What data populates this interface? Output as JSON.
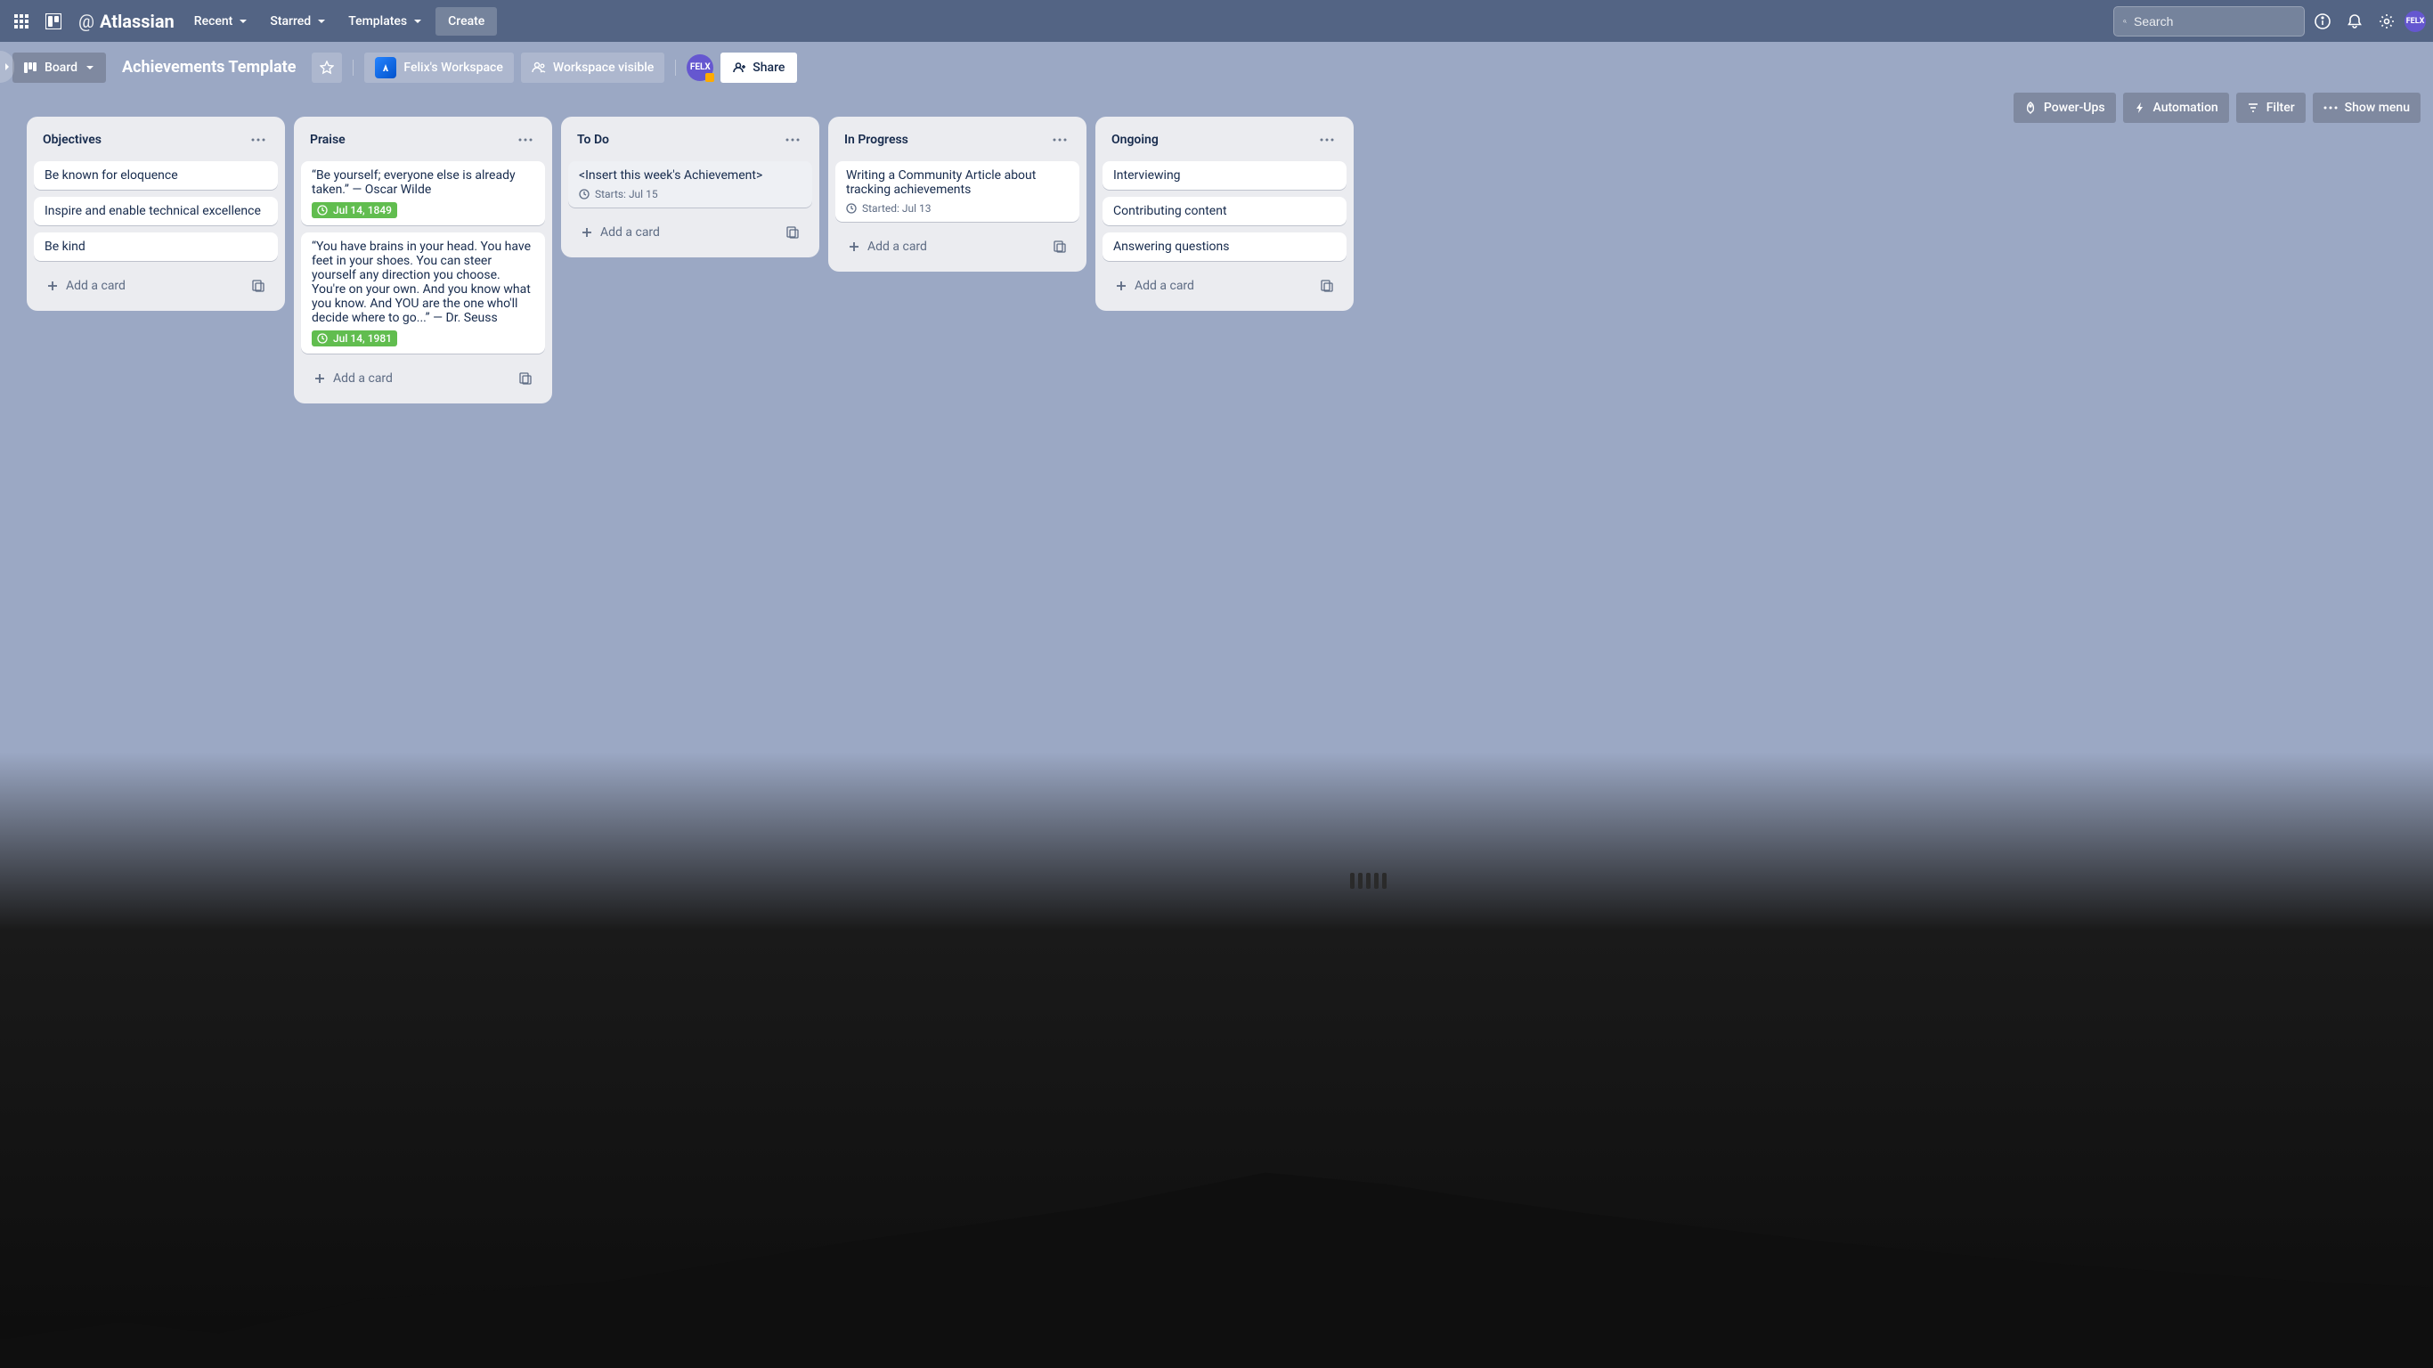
{
  "topnav": {
    "logo": "Atlassian",
    "menus": [
      "Recent",
      "Starred",
      "Templates"
    ],
    "create": "Create",
    "search_placeholder": "Search",
    "avatar": "FELX"
  },
  "boardbar": {
    "view_switch": "Board",
    "title": "Achievements Template",
    "workspace": "Felix's Workspace",
    "visibility": "Workspace visible",
    "member": "FELX",
    "share": "Share"
  },
  "toolbar": {
    "powerups": "Power-Ups",
    "automation": "Automation",
    "filter": "Filter",
    "show_menu": "Show menu"
  },
  "add_card_label": "Add a card",
  "lists": [
    {
      "title": "Objectives",
      "cards": [
        {
          "text": "Be known for eloquence"
        },
        {
          "text": "Inspire and enable technical excellence"
        },
        {
          "text": "Be kind"
        }
      ]
    },
    {
      "title": "Praise",
      "cards": [
        {
          "text": "“Be yourself; everyone else is already taken.” ― Oscar Wilde",
          "date_badge": "Jul 14, 1849"
        },
        {
          "text": "“You have brains in your head. You have feet in your shoes. You can steer yourself any direction you choose. You're on your own. And you know what you know. And YOU are the one who'll decide where to go...” ― Dr. Seuss",
          "date_badge": "Jul 14, 1981"
        }
      ]
    },
    {
      "title": "To Do",
      "cards": [
        {
          "text": "<Insert this week's Achievement>",
          "date_plain": "Starts: Jul 15",
          "muted": true
        }
      ]
    },
    {
      "title": "In Progress",
      "cards": [
        {
          "text": "Writing a Community Article about tracking achievements",
          "date_plain": "Started: Jul 13"
        }
      ]
    },
    {
      "title": "Ongoing",
      "cards": [
        {
          "text": "Interviewing"
        },
        {
          "text": "Contributing content"
        },
        {
          "text": "Answering questions"
        }
      ]
    }
  ]
}
